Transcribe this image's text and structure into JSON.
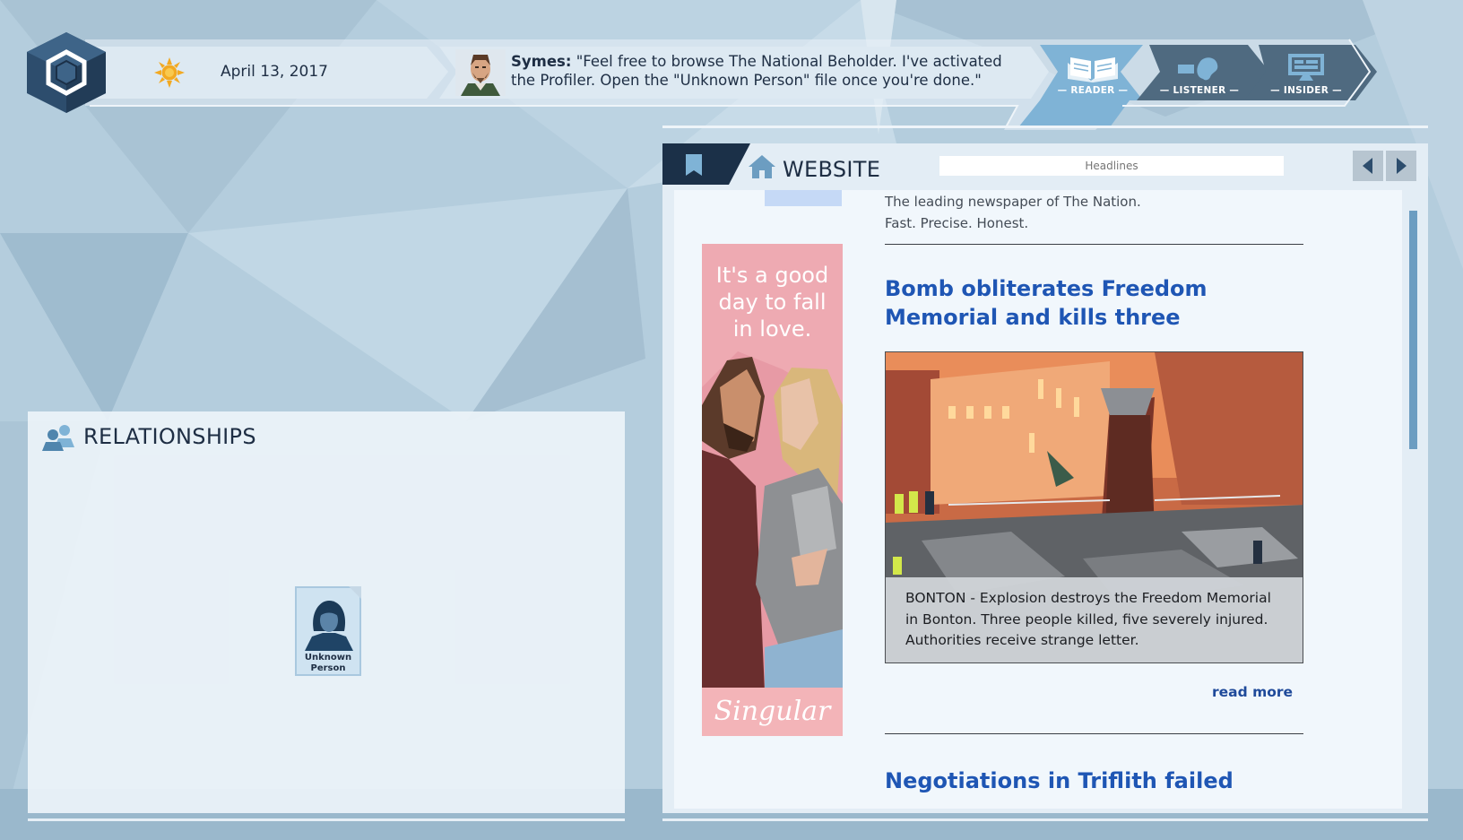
{
  "top_bar": {
    "date": "April 13, 2017",
    "weather_icon": "sun-icon",
    "speaker_name": "Symes:",
    "message": "\"Feel free to browse The National Beholder. I've activated the Profiler. Open the \"Unknown Person\" file once you're done.\"",
    "modes": [
      {
        "label": "— READER —",
        "icon": "book-icon",
        "active": true
      },
      {
        "label": "— LISTENER —",
        "icon": "ear-icon",
        "active": false
      },
      {
        "label": "— INSIDER —",
        "icon": "monitor-icon",
        "active": false
      }
    ]
  },
  "relationships": {
    "title": "RELATIONSHIPS",
    "people": [
      {
        "name_line1": "Unknown",
        "name_line2": "Person"
      }
    ]
  },
  "website": {
    "title": "WEBSITE",
    "address_placeholder": "Headlines",
    "tagline_line1": "The leading newspaper of The Nation.",
    "tagline_line2": "Fast. Precise. Honest.",
    "ad": {
      "text_line1": "It's a good",
      "text_line2": "day  to fall",
      "text_line3": "in love.",
      "brand": "Singular"
    },
    "articles": [
      {
        "headline": "Bomb obliterates Freedom Memorial and kills three",
        "caption": "BONTON - Explosion destroys the Freedom Memorial in Bonton. Three people killed, five severely injured. Authorities receive strange letter.",
        "read_more": "read more"
      },
      {
        "headline": "Negotiations in Triflith failed"
      }
    ]
  },
  "colors": {
    "background": "#b3ccdc",
    "panel": "#ecf3f9",
    "headline": "#1f56b4",
    "tab_active": "#7fb3d6",
    "tab_inactive": "#4f6a80",
    "dark_navy": "#1b3048"
  }
}
